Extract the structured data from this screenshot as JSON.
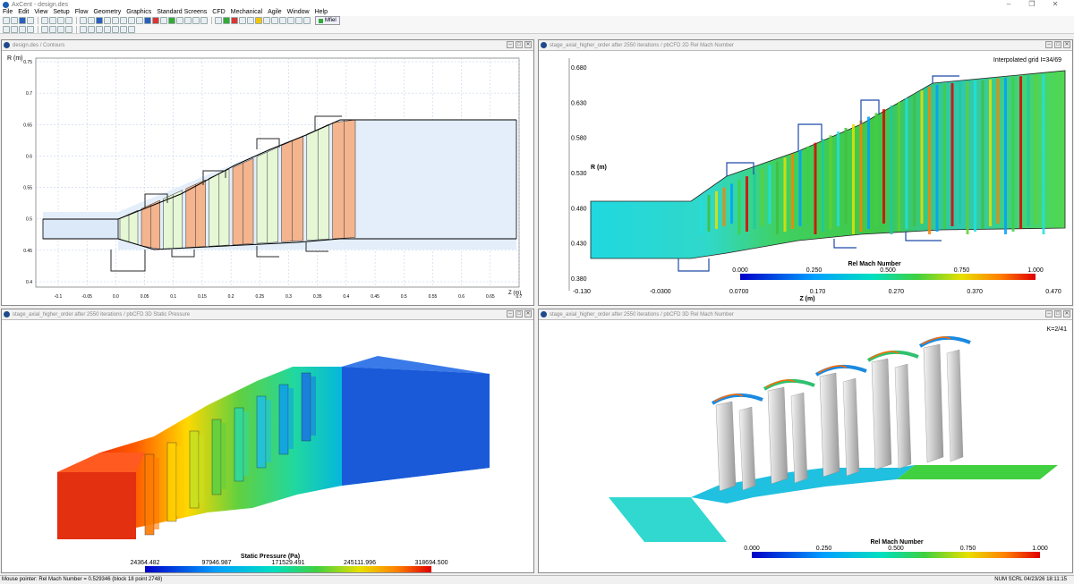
{
  "app": {
    "title": "AxCent - design.des",
    "win_min": "–",
    "win_max": "❐",
    "win_close": "✕"
  },
  "menu": [
    "File",
    "Edit",
    "View",
    "Setup",
    "Flow",
    "Geometry",
    "Graphics",
    "Standard Screens",
    "CFD",
    "Mechanical",
    "Agile",
    "Window",
    "Help"
  ],
  "toolbar": {
    "mfiel_label": "Mfiel"
  },
  "panels": {
    "contours": {
      "title": "design.des / Contours",
      "ylabel": "R (m)",
      "xlabel": "Z (m)",
      "yticks": [
        "0.75",
        "0.7",
        "0.65",
        "0.6",
        "0.55",
        "0.5",
        "0.45",
        "0.4"
      ],
      "xticks": [
        "-0.1",
        "-0.05",
        "0.0",
        "0.05",
        "0.1",
        "0.15",
        "0.2",
        "0.25",
        "0.3",
        "0.35",
        "0.4",
        "0.45",
        "0.5",
        "0.55",
        "0.6",
        "0.65",
        "0.7"
      ]
    },
    "mach2d": {
      "title": "stage_axial_higher_order after 2550 iterations / pbCFD 2D Rel Mach Number",
      "grid_label": "Interpolated grid  I=34/69",
      "ylabel": "R (m)",
      "xlabel": "Z (m)",
      "yticks": [
        "0.680",
        "0.630",
        "0.580",
        "0.530",
        "0.480",
        "0.430",
        "0.380"
      ],
      "xticks": [
        "-0.130",
        "-0.0300",
        "0.0700",
        "0.170",
        "0.270",
        "0.370",
        "0.470"
      ],
      "legend_title": "Rel Mach Number",
      "legend_ticks": [
        "0.000",
        "0.250",
        "0.500",
        "0.750",
        "1.000"
      ]
    },
    "pressure3d": {
      "title": "stage_axial_higher_order after 2550 iterations / pbCFD 3D Static Pressure",
      "legend_title": "Static Pressure (Pa)",
      "legend_ticks": [
        "24364.482",
        "97946.987",
        "171529.491",
        "245111.996",
        "318694.500"
      ]
    },
    "mach3d": {
      "title": "stage_axial_higher_order after 2550 iterations / pbCFD 3D Rel Mach Number",
      "k_label": "K=2/41",
      "legend_title": "Rel Mach Number",
      "legend_ticks": [
        "0.000",
        "0.250",
        "0.500",
        "0.750",
        "1.000"
      ]
    }
  },
  "status": {
    "left": "Mouse pointer: Rel Mach Number = 0.529346   (block 18 point 2748)",
    "right": "NUM  SCRL  04/23/26  18:11:15"
  },
  "colors": {
    "accent": "#1e4a8c",
    "axial_blue": "#e3eefa",
    "stator_green": "#e6f7d6",
    "rotor_orange": "#f3b48e"
  }
}
